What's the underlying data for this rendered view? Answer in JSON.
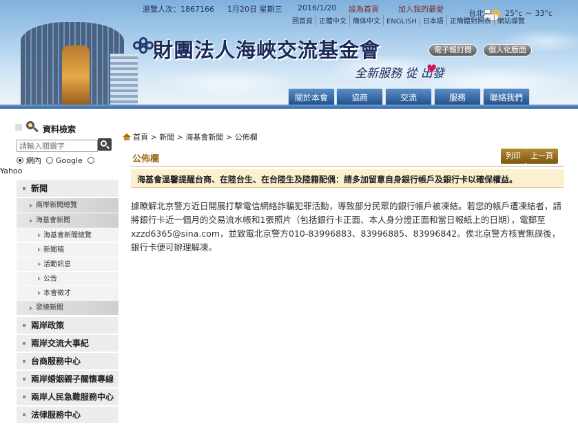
{
  "topbar": {
    "visitors": "瀏覽人次：1867166",
    "lunar_date": "1月20日 星期三",
    "date": "2016/1/20",
    "set_homepage": "設為首頁",
    "add_favorite": "加入我的最愛",
    "city": "台北",
    "temperature": "25°c － 33°c"
  },
  "lang_links": [
    "回首頁",
    "正體中文",
    "簡体中文",
    "ENGLISH",
    "日本語",
    "正簡體對照表",
    "網站導覽"
  ],
  "site": {
    "title": "財團法人海峽交流基金會",
    "slogan": "全新服務 從   出發",
    "e_newsletter": "電子報訂閱",
    "personal": "個人化版面"
  },
  "main_nav": [
    "關於本會",
    "協商",
    "交流",
    "服務",
    "聯絡我們"
  ],
  "sidebar": {
    "search_title": "資料檢索",
    "search_placeholder": "請輸入關鍵字",
    "radio_options": [
      "網內",
      "Google",
      "Yahoo"
    ],
    "menu": [
      {
        "label": "新聞",
        "level": 1
      },
      {
        "label": "兩岸新聞總覽",
        "level": 2
      },
      {
        "label": "海基會新聞",
        "level": 2
      },
      {
        "label": "海基會新聞總覽",
        "level": 3
      },
      {
        "label": "新聞稿",
        "level": 3
      },
      {
        "label": "活動訊息",
        "level": 3
      },
      {
        "label": "公告",
        "level": 3
      },
      {
        "label": "本會徵才",
        "level": 3
      },
      {
        "label": "發燒新聞",
        "level": 2
      },
      {
        "label": "兩岸政策",
        "level": 1
      },
      {
        "label": "兩岸交流大事紀",
        "level": 1
      },
      {
        "label": "台商服務中心",
        "level": 1
      },
      {
        "label": "兩岸婚姻親子關懷專線",
        "level": 1
      },
      {
        "label": "兩岸人民急難服務中心",
        "level": 1
      },
      {
        "label": "法律服務中心",
        "level": 1
      }
    ]
  },
  "content": {
    "breadcrumb": "首頁 > 新聞 > 海基會新聞 > 公佈欄",
    "section_title": "公佈欄",
    "print_label": "列印",
    "prev_label": "上一頁",
    "headline": "海基會溫馨提醒台商、在陸台生、在台陸生及陸籍配偶：請多加留意自身銀行帳戶及銀行卡以確保權益。",
    "body": "據瞭解北京警方近日開展打擊電信網絡詐騙犯罪活動，導致部分民眾的銀行帳戶被凍結。若您的帳戶遭凍結者，請將銀行卡近一個月的交易流水帳和1張照片（包括銀行卡正面、本人身分證正面和當日報紙上的日期），電郵至xzzd6365@sina.com，並致電北京警方010-83996883、83996885、83996842。俟北京警方核實無誤後，銀行卡便可辦理解凍。"
  }
}
